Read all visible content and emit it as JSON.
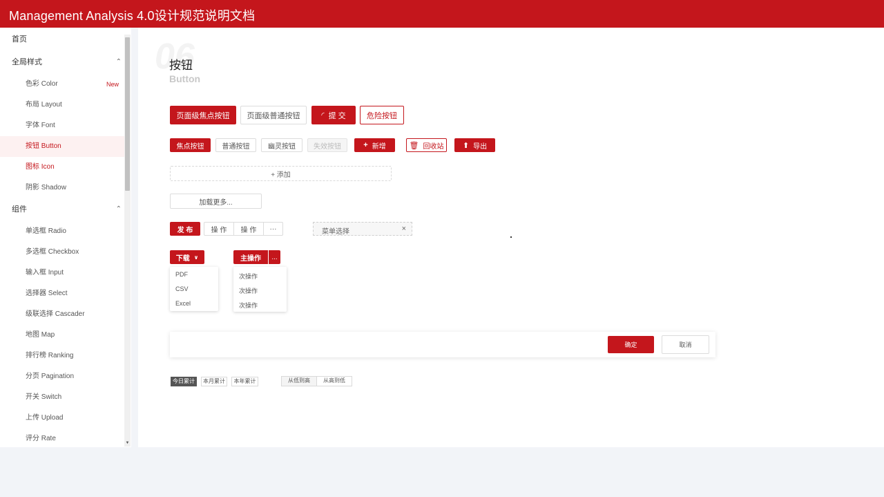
{
  "app": {
    "title": "Management Analysis 4.0设计规范说明文档"
  },
  "sidebar": {
    "home": "首页",
    "global_style": {
      "label": "全局样式",
      "items": [
        {
          "label": "色彩 Color",
          "badge": "New"
        },
        {
          "label": "布局 Layout"
        },
        {
          "label": "字体 Font"
        },
        {
          "label": "按钮 Button"
        },
        {
          "label": "图标 Icon"
        },
        {
          "label": "阴影 Shadow"
        }
      ]
    },
    "components": {
      "label": "组件",
      "items": [
        "单选框 Radio",
        "多选框 Checkbox",
        "输入框 Input",
        "选择器 Select",
        "级联选择 Cascader",
        "地图  Map",
        "排行榜  Ranking",
        "分页 Pagination",
        "开关 Switch",
        "上传 Upload",
        "评分 Rate"
      ]
    }
  },
  "section": {
    "number": "06",
    "title": "按钮",
    "subtitle": "Button"
  },
  "row1": {
    "focus": "页面级焦点按钮",
    "normal": "页面级普通按钮",
    "submit": "提 交",
    "danger": "危险按钮"
  },
  "row2": {
    "focus": "焦点按钮",
    "normal": "普通按钮",
    "ghost": "幽灵按钮",
    "disabled": "失效按钮",
    "add": "新增",
    "recycle": "回收站",
    "export": "导出"
  },
  "add_dashed": "+ 添加",
  "load_more": "加载更多...",
  "group": {
    "publish": "发 布",
    "op1": "操 作",
    "op2": "操 作",
    "more": "···"
  },
  "tag": {
    "text": "菜单选择",
    "close": "×"
  },
  "download": {
    "label": "下载",
    "items": [
      "PDF",
      "CSV",
      "Excel"
    ]
  },
  "main_op": {
    "label": "主操作",
    "more": "...",
    "items": [
      "次操作",
      "次操作",
      "次操作"
    ]
  },
  "footer": {
    "ok": "确定",
    "cancel": "取消"
  },
  "period": [
    "今日累计",
    "本月累计",
    "本年累计"
  ],
  "sort": [
    "从低到高",
    "从高到低"
  ],
  "colors": {
    "brand": "#c4161c"
  }
}
